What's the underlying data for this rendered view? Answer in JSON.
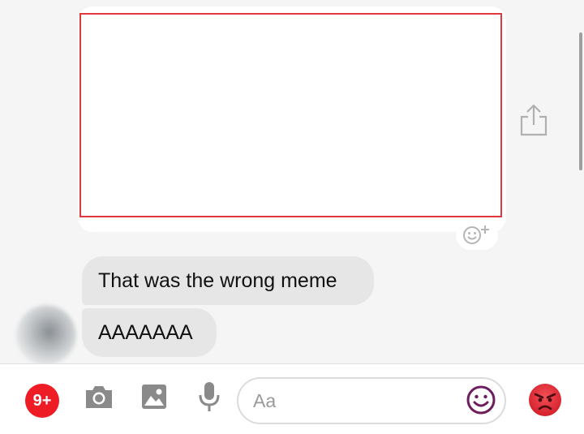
{
  "messages": [
    {
      "text": "That was the wrong meme"
    },
    {
      "text": "AAAAAAA"
    }
  ],
  "composer": {
    "badge_count": "9+",
    "placeholder": "Aa"
  },
  "colors": {
    "badge": "#ee1d25",
    "emoji_icon": "#6b1d5e",
    "angry_reaction": "#e8323c",
    "image_border": "#e0393e"
  },
  "icons": [
    "share-icon",
    "add-reaction-icon",
    "camera-icon",
    "gallery-icon",
    "microphone-icon",
    "emoji-icon",
    "angry-face-icon"
  ]
}
